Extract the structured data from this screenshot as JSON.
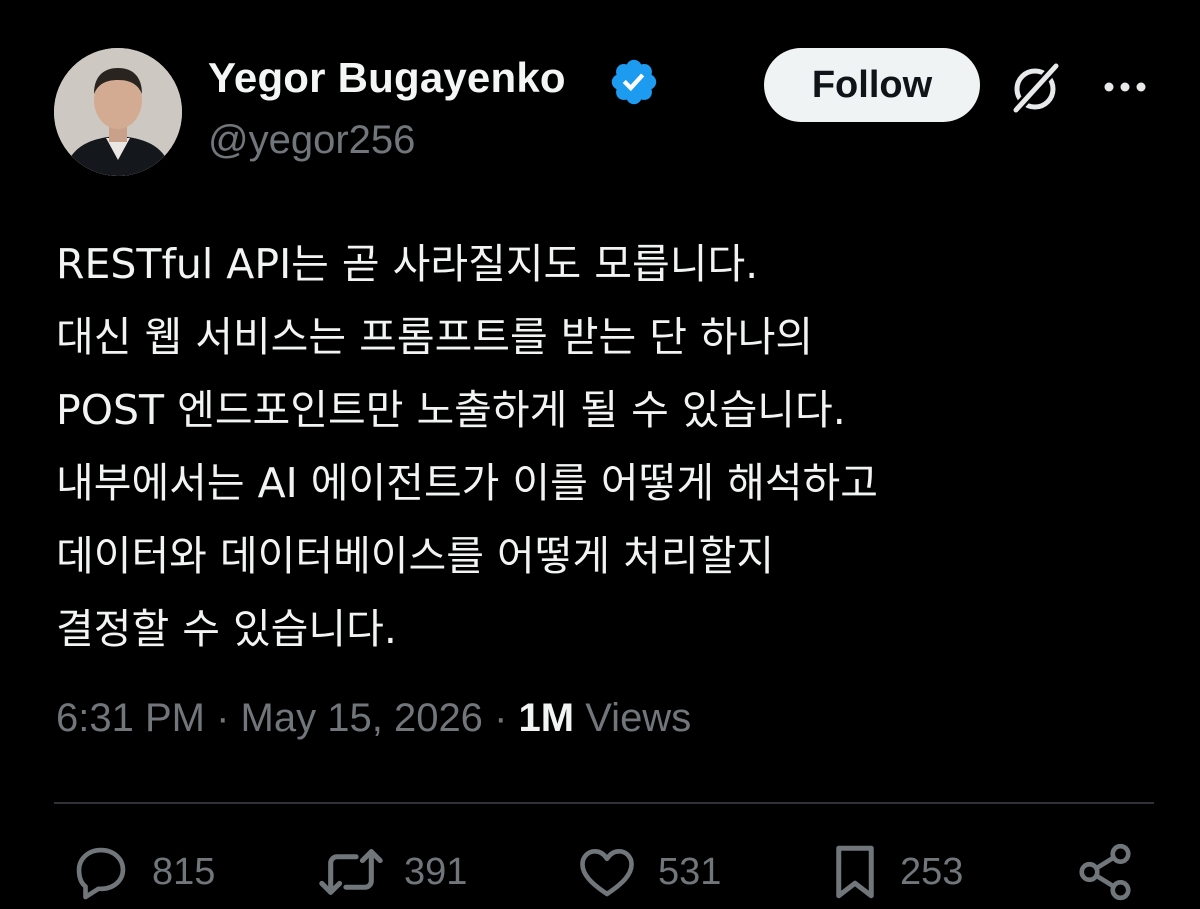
{
  "author": {
    "display_name": "Yegor Bugayenko",
    "handle": "@yegor256",
    "verified": true,
    "verified_color": "#1d9bf0",
    "avatar_icon": "profile-photo"
  },
  "header": {
    "follow_label": "Follow",
    "grok_icon": "grok-icon",
    "more_icon": "ellipsis-icon"
  },
  "tweet": {
    "lines": [
      "RESTful API는 곧 사라질지도 모릅니다.",
      "대신 웹 서비스는 프롬프트를 받는 단 하나의",
      "POST 엔드포인트만 노출하게 될 수 있습니다.",
      "내부에서는 AI 에이전트가 이를 어떻게 해석하고",
      "데이터와 데이터베이스를 어떻게 처리할지",
      "결정할 수 있습니다."
    ]
  },
  "meta": {
    "time": "6:31 PM",
    "separator": "·",
    "date": "May 15, 2026",
    "views_count": "1M",
    "views_label": "Views"
  },
  "actions": {
    "replies": "815",
    "reposts": "391",
    "likes": "531",
    "bookmarks": "253"
  },
  "colors": {
    "background": "#000000",
    "text": "#e7e9ea",
    "secondary": "#71767b",
    "divider": "#2f3336",
    "follow_bg": "#eff3f4"
  }
}
